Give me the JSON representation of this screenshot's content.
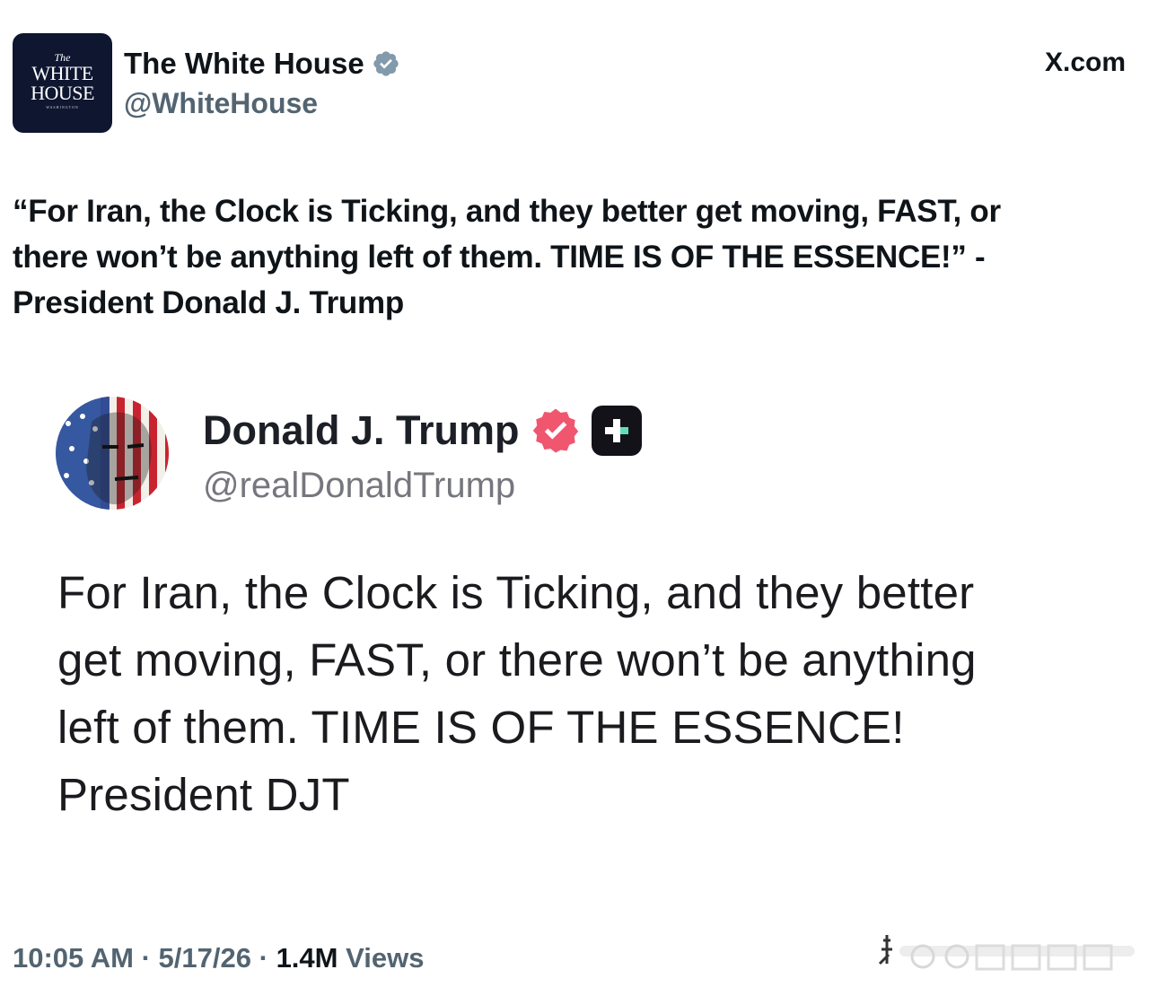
{
  "header": {
    "logo_text": [
      "The",
      "WHITE",
      "HOUSE",
      "WASHINGTON"
    ],
    "display_name": "The White House",
    "handle": "@WhiteHouse",
    "site_label": "X.com"
  },
  "post": {
    "quote_line1": "“For Iran, the Clock is Ticking, and they better get moving, FAST, or",
    "quote_line2": "there won’t be anything left of them. TIME IS OF THE ESSENCE!” -",
    "quote_line3": "President Donald J. Trump"
  },
  "embed": {
    "display_name": "Donald J. Trump",
    "handle": "@realDonaldTrump",
    "body_lines": [
      "For Iran, the Clock is Ticking, and they better",
      "get moving, FAST, or there won’t be anything",
      "left of them. TIME IS OF THE ESSENCE!",
      "President DJT"
    ],
    "icons": {
      "verified": "truth-verified-badge-icon",
      "plus": "truth-plus-icon"
    }
  },
  "footer": {
    "time": "10:05 AM",
    "separator": "·",
    "date": "5/17/26",
    "views_count": "1.4M",
    "views_label": "Views"
  },
  "colors": {
    "text_primary": "#0f1419",
    "text_secondary": "#536471",
    "logo_bg": "#0e1630",
    "truth_badge": "#f0566e"
  }
}
